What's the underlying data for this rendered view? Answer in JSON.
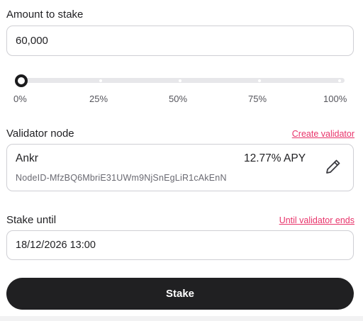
{
  "amount": {
    "label": "Amount to stake",
    "value": "60,000"
  },
  "slider": {
    "ticks": [
      "0%",
      "25%",
      "50%",
      "75%",
      "100%"
    ],
    "value_percent": 0
  },
  "validator": {
    "label": "Validator node",
    "create_link": "Create validator",
    "name": "Ankr",
    "apy": "12.77% APY",
    "node_id": "NodeID-MfzBQ6MbriE31UWm9NjSnEgLiR1cAkEnN"
  },
  "stake_until": {
    "label": "Stake until",
    "link": "Until validator ends",
    "value": "18/12/2026 13:00"
  },
  "actions": {
    "stake_label": "Stake"
  },
  "icons": {
    "edit": "pencil-icon"
  },
  "colors": {
    "accent_link": "#e8336a",
    "button_bg": "#202022",
    "border": "#cfcfd4"
  }
}
